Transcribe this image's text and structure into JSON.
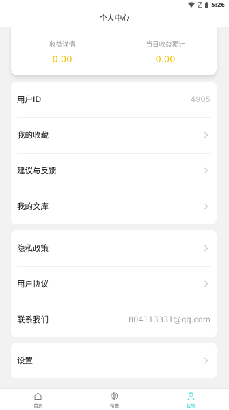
{
  "status_bar": {
    "time": "5:26"
  },
  "header": {
    "title": "个人中心"
  },
  "earnings": {
    "detail_label": "收益详情",
    "detail_value": "0.00",
    "daily_label": "当日收益累计",
    "daily_value": "0.00",
    "value_color": "#f3c300"
  },
  "group1": {
    "user_id_label": "用户ID",
    "user_id_value": "4905",
    "favorites_label": "我的收藏",
    "feedback_label": "建议与反馈",
    "library_label": "我的文库"
  },
  "group2": {
    "privacy_label": "隐私政策",
    "agreement_label": "用户协议",
    "contact_label": "联系我们",
    "contact_value": "804113331@qq.com"
  },
  "group3": {
    "settings_label": "设置"
  },
  "tabbar": {
    "home_label": "首页",
    "featured_label": "精选",
    "mine_label": "我的",
    "active_color": "#2ad4c8"
  },
  "icons": [
    "wifi-icon",
    "signal-icon",
    "battery-icon",
    "chevron-right-icon",
    "home-icon",
    "gear-icon",
    "user-icon"
  ]
}
